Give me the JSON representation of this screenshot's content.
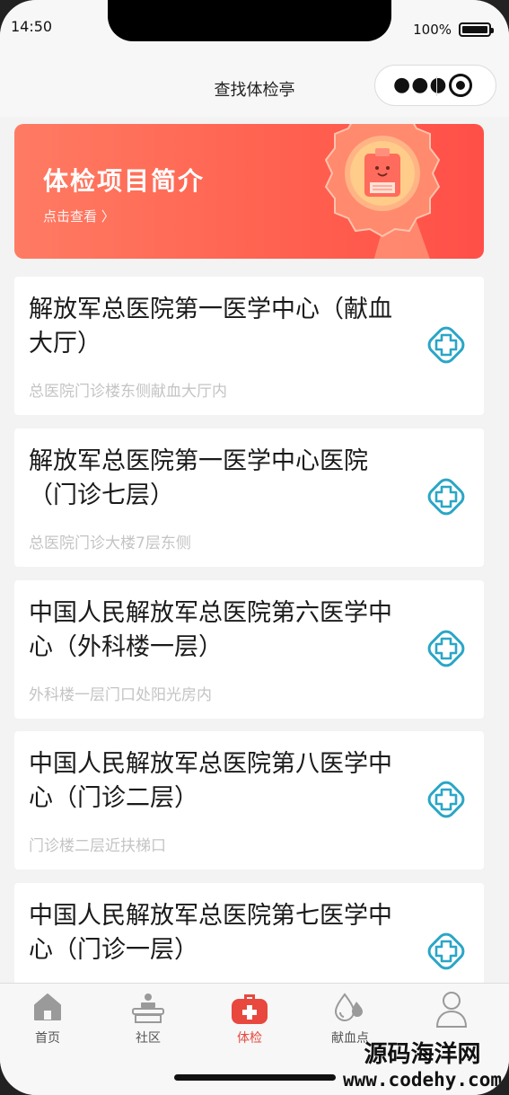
{
  "status_bar": {
    "time": "14:50",
    "battery": "100%"
  },
  "nav": {
    "title": "查找体检亭"
  },
  "banner": {
    "title": "体检项目简介",
    "link": "点击查看 〉"
  },
  "hospitals": [
    {
      "name": "解放军总医院第一医学中心（献血大厅）",
      "address": "总医院门诊楼东侧献血大厅内"
    },
    {
      "name": "解放军总医院第一医学中心医院（门诊七层）",
      "address": "总医院门诊大楼7层东侧"
    },
    {
      "name": "中国人民解放军总医院第六医学中心（外科楼一层）",
      "address": "外科楼一层门口处阳光房内"
    },
    {
      "name": "中国人民解放军总医院第八医学中心（门诊二层）",
      "address": "门诊楼二层近扶梯口"
    },
    {
      "name": "中国人民解放军总医院第七医学中心（门诊一层）",
      "address": ""
    }
  ],
  "tabs": [
    {
      "label": "首页",
      "icon": "home-icon"
    },
    {
      "label": "社区",
      "icon": "community-icon"
    },
    {
      "label": "体检",
      "icon": "medical-kit-icon"
    },
    {
      "label": "献血点",
      "icon": "blood-drop-icon"
    },
    {
      "label": "",
      "icon": "user-icon"
    }
  ],
  "watermark": {
    "line1": "源码海洋网",
    "line2": "www.codehy.com"
  },
  "colors": {
    "accent": "#e8483d",
    "add_icon": "#2aa6c6",
    "banner": "#ff6250"
  }
}
